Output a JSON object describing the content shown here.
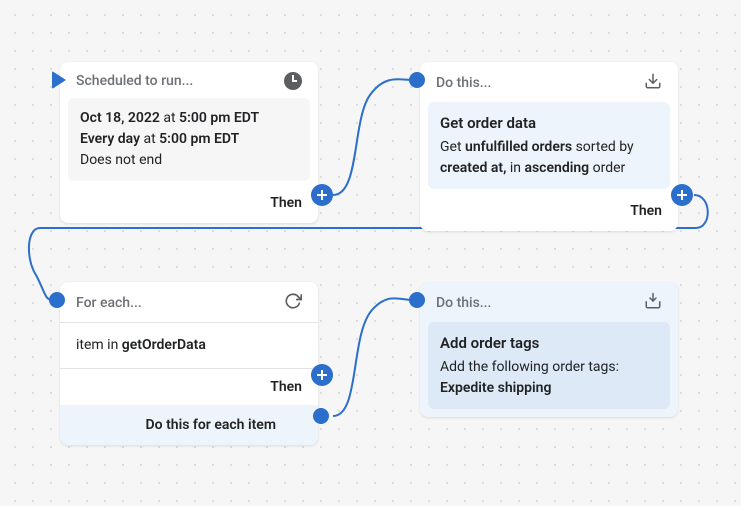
{
  "cards": {
    "schedule": {
      "header": "Scheduled to run...",
      "date": "Oct 18, 2022",
      "at_word": " at ",
      "time1": "5:00 pm EDT",
      "every": "Every day",
      "time2": "5:00 pm EDT",
      "no_end": "Does not end",
      "then": "Then"
    },
    "get_order": {
      "header": "Do this...",
      "title": "Get order data",
      "l1a": "Get ",
      "l1b": "unfulfilled orders",
      "l1c": " sorted by",
      "l2a": "created at,",
      "l2b": " in ",
      "l2c": "ascending",
      "l2d": " order",
      "then": "Then"
    },
    "foreach": {
      "header": "For each...",
      "item_in": "item in ",
      "source": "getOrderData",
      "then": "Then",
      "footer": "Do this for each item"
    },
    "add_tags": {
      "header": "Do this...",
      "title": "Add order tags",
      "subtitle": "Add the following order tags:",
      "tag": "Expedite shipping"
    }
  }
}
